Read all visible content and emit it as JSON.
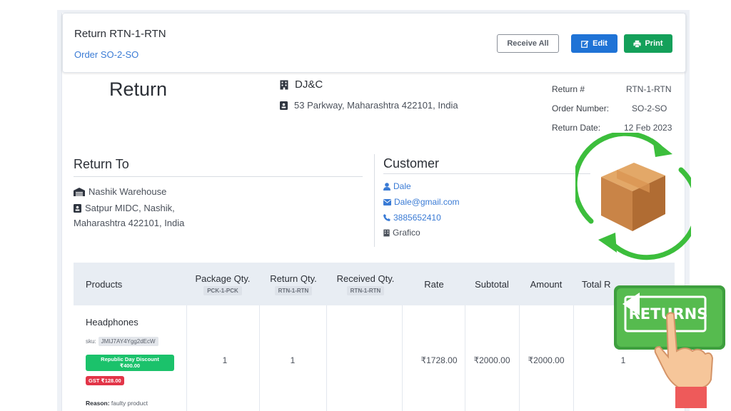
{
  "header": {
    "title": "Return RTN-1-RTN",
    "order_link": "Order SO-2-SO",
    "receive_all_label": "Receive All",
    "edit_label": "Edit",
    "print_label": "Print"
  },
  "document": {
    "title": "Return",
    "company_name": "DJ&C",
    "company_address": "53 Parkway, Maharashtra 422101, India",
    "meta": [
      {
        "label": "Return #",
        "value": "RTN-1-RTN"
      },
      {
        "label": "Order Number:",
        "value": "SO-2-SO"
      },
      {
        "label": "Return Date:",
        "value": "12 Feb 2023"
      }
    ]
  },
  "return_to": {
    "title": "Return To",
    "warehouse": "Nashik Warehouse",
    "address_line1": "Satpur MIDC, Nashik,",
    "address_line2": "Maharashtra 422101, India"
  },
  "customer": {
    "title": "Customer",
    "name": "Dale",
    "email": "Dale@gmail.com",
    "phone": "3885652410",
    "company": "Grafico"
  },
  "table": {
    "headers": {
      "products": "Products",
      "package_qty": "Package Qty.",
      "package_ref": "PCK-1-PCK",
      "return_qty": "Return Qty.",
      "return_ref": "RTN-1-RTN",
      "received_qty": "Received Qty.",
      "received_ref": "RTN-1-RTN",
      "rate": "Rate",
      "subtotal": "Subtotal",
      "amount": "Amount",
      "total": "Total R"
    },
    "row": {
      "product": "Headphones",
      "sku_label": "sku:",
      "sku": "JMIJ7AY4Ygg2dEcW",
      "discount_name": "Republic Day Discount",
      "discount_amount": "₹400.00",
      "gst": "GST ₹128.00",
      "reason_label": "Reason:",
      "reason": "faulty product",
      "package_qty": "1",
      "return_qty": "1",
      "received_qty": "",
      "rate": "₹1728.00",
      "subtotal": "₹2000.00",
      "amount": "₹2000.00",
      "total": "1"
    }
  },
  "overlay": {
    "returns_sign": "RETURNS"
  },
  "colors": {
    "primary": "#1f73d6",
    "success": "#14a05a",
    "link": "#3a7bd5",
    "danger": "#e23548",
    "discount": "#1bc26b",
    "cycle_arrow": "#3cbe3c"
  }
}
